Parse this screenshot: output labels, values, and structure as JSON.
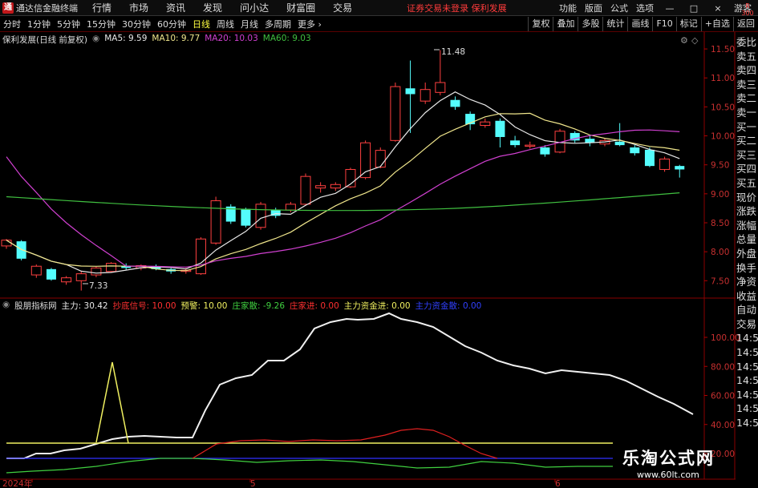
{
  "app": {
    "title": "通达信金融终端",
    "logo": "通",
    "menus": [
      "行情",
      "市场",
      "资讯",
      "发现",
      "问小达",
      "财富圈",
      "交易"
    ],
    "warning": "证券交易未登录  保利发展",
    "right_menus": [
      "功能",
      "版面",
      "公式",
      "选项"
    ],
    "window_buttons": [
      "—",
      "□",
      "×"
    ],
    "guest": "游客"
  },
  "periods": [
    "分时",
    "1分钟",
    "5分钟",
    "15分钟",
    "30分钟",
    "60分钟",
    "日线",
    "周线",
    "月线",
    "多周期",
    "更多 ›"
  ],
  "active_period": "日线",
  "tools": [
    "复权",
    "叠加",
    "多股",
    "统计",
    "画线",
    "F10",
    "标记",
    "+自选",
    "返回"
  ],
  "badge": "R\n300",
  "main": {
    "stock_label": "保利发展(日线 前复权)",
    "ma": [
      {
        "label": "MA5: 9.59",
        "color": "#e8e8e8"
      },
      {
        "label": "MA10: 9.77",
        "color": "#f0e68c"
      },
      {
        "label": "MA20: 10.03",
        "color": "#d040d0"
      },
      {
        "label": "MA60: 9.03",
        "color": "#40c040"
      }
    ],
    "high_label": "11.48",
    "low_label": "7.33"
  },
  "indicator": {
    "name": "股朋指标网",
    "items": [
      {
        "label": "主力: 30.42",
        "color": "#e8e8e8"
      },
      {
        "label": "抄底信号: 10.00",
        "color": "#ff3030"
      },
      {
        "label": "预警: 10.00",
        "color": "#f0f060"
      },
      {
        "label": "庄家散: -9.26",
        "color": "#40d040"
      },
      {
        "label": "庄家进: 0.00",
        "color": "#ff3030"
      },
      {
        "label": "主力资金进: 0.00",
        "color": "#f0f060"
      },
      {
        "label": "主力资金散: 0.00",
        "color": "#3040ff"
      }
    ]
  },
  "right_labels": [
    "委比",
    "卖五",
    "卖四",
    "卖三",
    "卖二",
    "卖一",
    "买一",
    "买二",
    "买三",
    "买四",
    "买五",
    "现价",
    "涨跌",
    "涨幅",
    "总量",
    "外盘",
    "换手",
    "净资",
    "收益",
    "自动",
    "交易",
    "14:56",
    "14:56",
    "14:56",
    "14:56",
    "14:56",
    "14:56",
    "14:56"
  ],
  "price_axis": [
    "11.50",
    "11.00",
    "10.50",
    "10.00",
    "9.50",
    "9.00",
    "8.50",
    "8.00",
    "7.50"
  ],
  "ind_axis": [
    "100.00",
    "80.00",
    "60.00",
    "40.00",
    "20.00"
  ],
  "x_axis": [
    "2024年",
    "5",
    "6"
  ],
  "watermark": {
    "line1": "乐淘公式网",
    "line2": "www.60lt.com"
  },
  "chart_data": {
    "type": "candlestick",
    "candles": [
      {
        "o": 8.1,
        "c": 8.2,
        "h": 8.22,
        "l": 8.05
      },
      {
        "o": 8.18,
        "c": 7.88,
        "h": 8.2,
        "l": 7.85
      },
      {
        "o": 7.6,
        "c": 7.75,
        "h": 7.78,
        "l": 7.55
      },
      {
        "o": 7.7,
        "c": 7.52,
        "h": 7.72,
        "l": 7.5
      },
      {
        "o": 7.48,
        "c": 7.55,
        "h": 7.58,
        "l": 7.43
      },
      {
        "o": 7.5,
        "c": 7.62,
        "h": 7.66,
        "l": 7.33
      },
      {
        "o": 7.6,
        "c": 7.72,
        "h": 7.74,
        "l": 7.56
      },
      {
        "o": 7.66,
        "c": 7.8,
        "h": 7.82,
        "l": 7.64
      },
      {
        "o": 7.76,
        "c": 7.72,
        "h": 7.8,
        "l": 7.68
      },
      {
        "o": 7.72,
        "c": 7.76,
        "h": 7.78,
        "l": 7.68
      },
      {
        "o": 7.75,
        "c": 7.7,
        "h": 7.78,
        "l": 7.68
      },
      {
        "o": 7.7,
        "c": 7.66,
        "h": 7.72,
        "l": 7.62
      },
      {
        "o": 7.66,
        "c": 7.68,
        "h": 7.72,
        "l": 7.62
      },
      {
        "o": 7.62,
        "c": 8.22,
        "h": 8.25,
        "l": 7.6
      },
      {
        "o": 8.15,
        "c": 8.88,
        "h": 8.95,
        "l": 8.12
      },
      {
        "o": 8.78,
        "c": 8.52,
        "h": 8.82,
        "l": 8.48
      },
      {
        "o": 8.74,
        "c": 8.45,
        "h": 8.76,
        "l": 8.42
      },
      {
        "o": 8.42,
        "c": 8.82,
        "h": 8.86,
        "l": 8.38
      },
      {
        "o": 8.72,
        "c": 8.62,
        "h": 8.76,
        "l": 8.58
      },
      {
        "o": 8.72,
        "c": 8.82,
        "h": 8.86,
        "l": 8.68
      },
      {
        "o": 8.82,
        "c": 9.3,
        "h": 9.35,
        "l": 8.8
      },
      {
        "o": 9.1,
        "c": 9.14,
        "h": 9.2,
        "l": 9.02
      },
      {
        "o": 9.1,
        "c": 9.16,
        "h": 9.2,
        "l": 9.05
      },
      {
        "o": 9.12,
        "c": 9.42,
        "h": 9.45,
        "l": 9.1
      },
      {
        "o": 9.28,
        "c": 9.88,
        "h": 9.92,
        "l": 9.25
      },
      {
        "o": 9.46,
        "c": 9.75,
        "h": 9.8,
        "l": 9.44
      },
      {
        "o": 9.92,
        "c": 10.85,
        "h": 10.92,
        "l": 9.9
      },
      {
        "o": 10.82,
        "c": 10.72,
        "h": 11.3,
        "l": 10.05
      },
      {
        "o": 10.6,
        "c": 10.8,
        "h": 10.92,
        "l": 10.55
      },
      {
        "o": 10.75,
        "c": 10.92,
        "h": 11.48,
        "l": 10.7
      },
      {
        "o": 10.62,
        "c": 10.5,
        "h": 10.68,
        "l": 10.45
      },
      {
        "o": 10.38,
        "c": 10.2,
        "h": 10.42,
        "l": 10.1
      },
      {
        "o": 10.18,
        "c": 10.24,
        "h": 10.3,
        "l": 10.14
      },
      {
        "o": 10.26,
        "c": 9.98,
        "h": 10.3,
        "l": 9.8
      },
      {
        "o": 9.92,
        "c": 9.84,
        "h": 10.0,
        "l": 9.8
      },
      {
        "o": 9.82,
        "c": 9.84,
        "h": 9.9,
        "l": 9.78
      },
      {
        "o": 9.8,
        "c": 9.68,
        "h": 9.84,
        "l": 9.64
      },
      {
        "o": 9.72,
        "c": 10.08,
        "h": 10.12,
        "l": 9.7
      },
      {
        "o": 10.05,
        "c": 9.92,
        "h": 10.08,
        "l": 9.88
      },
      {
        "o": 9.95,
        "c": 9.88,
        "h": 10.0,
        "l": 9.82
      },
      {
        "o": 9.86,
        "c": 9.92,
        "h": 9.96,
        "l": 9.82
      },
      {
        "o": 9.9,
        "c": 9.84,
        "h": 10.22,
        "l": 9.82
      },
      {
        "o": 9.8,
        "c": 9.7,
        "h": 9.84,
        "l": 9.66
      },
      {
        "o": 9.76,
        "c": 9.48,
        "h": 9.8,
        "l": 9.46
      },
      {
        "o": 9.42,
        "c": 9.6,
        "h": 9.64,
        "l": 9.38
      },
      {
        "o": 9.48,
        "c": 9.42,
        "h": 9.5,
        "l": 9.28
      }
    ]
  }
}
